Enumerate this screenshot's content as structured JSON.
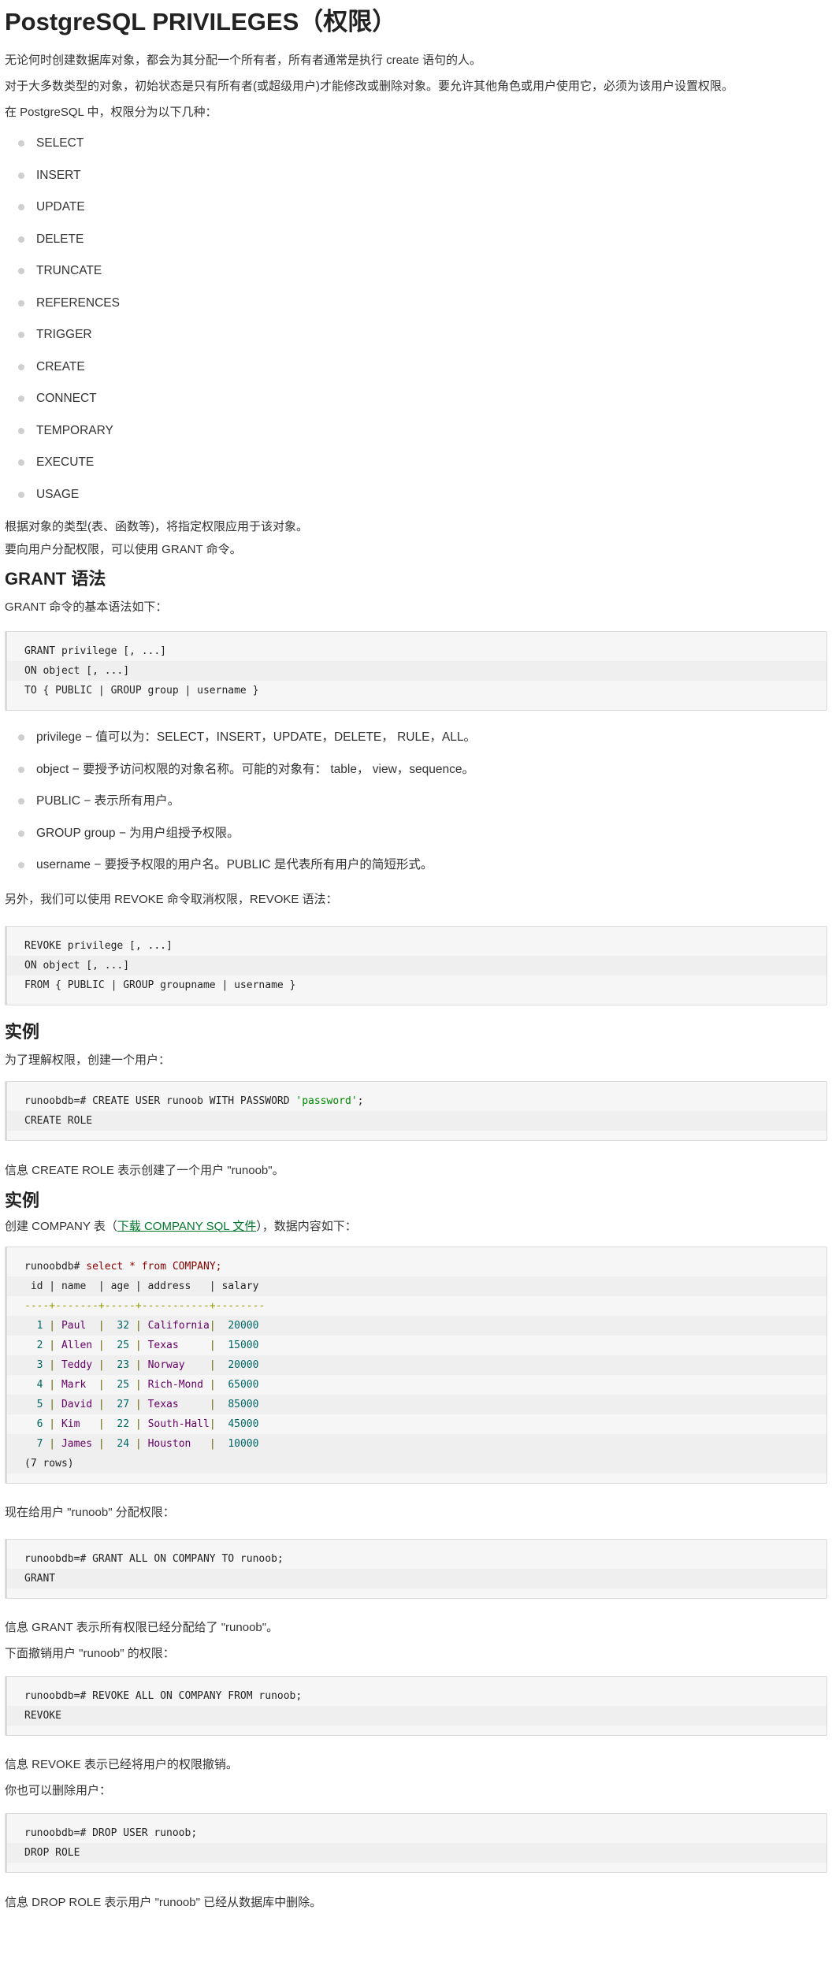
{
  "title": "PostgreSQL PRIVILEGES（权限）",
  "intro": [
    "无论何时创建数据库对象，都会为其分配一个所有者，所有者通常是执行 create 语句的人。",
    "对于大多数类型的对象，初始状态是只有所有者(或超级用户)才能修改或删除对象。要允许其他角色或用户使用它，必须为该用户设置权限。",
    "在 PostgreSQL 中，权限分为以下几种："
  ],
  "privileges": [
    "SELECT",
    "INSERT",
    "UPDATE",
    "DELETE",
    "TRUNCATE",
    "REFERENCES",
    "TRIGGER",
    "CREATE",
    "CONNECT",
    "TEMPORARY",
    "EXECUTE",
    "USAGE"
  ],
  "after_list": [
    "根据对象的类型(表、函数等)，将指定权限应用于该对象。",
    "要向用户分配权限，可以使用 GRANT 命令。"
  ],
  "grant_section": {
    "heading": "GRANT 语法",
    "intro": "GRANT 命令的基本语法如下：",
    "params": [
      "privilege − 值可以为：SELECT，INSERT，UPDATE，DELETE， RULE，ALL。",
      "object − 要授予访问权限的对象名称。可能的对象有： table， view，sequence。",
      "PUBLIC − 表示所有用户。",
      "GROUP group − 为用户组授予权限。",
      "username − 要授予权限的用户名。PUBLIC 是代表所有用户的简短形式。"
    ],
    "revoke_intro": "另外，我们可以使用 REVOKE 命令取消权限，REVOKE 语法："
  },
  "example1": {
    "heading": "实例",
    "intro": "为了理解权限，创建一个用户：",
    "after": "信息 CREATE ROLE 表示创建了一个用户 \"runoob\"。"
  },
  "example2": {
    "heading": "实例",
    "intro_before_link": "创建 COMPANY 表（",
    "link_text": "下载 COMPANY SQL 文件",
    "intro_after_link": "），数据内容如下：",
    "prompt": "runoobdb# ",
    "query": "select * from COMPANY;",
    "columns": [
      "id",
      "name",
      "age",
      "address",
      "salary"
    ],
    "header_line": " id | name  | age | address   | salary",
    "divider_line": "----+-------+-----+-----------+--------",
    "rows": [
      {
        "id": "1",
        "name": "Paul",
        "age": "32",
        "address": "California",
        "salary": "20000"
      },
      {
        "id": "2",
        "name": "Allen",
        "age": "25",
        "address": "Texas",
        "salary": "15000"
      },
      {
        "id": "3",
        "name": "Teddy",
        "age": "23",
        "address": "Norway",
        "salary": "20000"
      },
      {
        "id": "4",
        "name": "Mark",
        "age": "25",
        "address": "Rich-Mond",
        "salary": "65000"
      },
      {
        "id": "5",
        "name": "David",
        "age": "27",
        "address": "Texas",
        "salary": "85000"
      },
      {
        "id": "6",
        "name": "Kim",
        "age": "22",
        "address": "South-Hall",
        "salary": "45000"
      },
      {
        "id": "7",
        "name": "James",
        "age": "24",
        "address": "Houston",
        "salary": "10000"
      }
    ],
    "row_count": "(7 rows)",
    "grant_intro": "现在给用户 \"runoob\" 分配权限：",
    "grant_after": "信息 GRANT 表示所有权限已经分配给了 \"runoob\"。",
    "revoke_intro": "下面撤销用户 \"runoob\" 的权限：",
    "revoke_after": "信息 REVOKE 表示已经将用户的权限撤销。",
    "drop_intro": "你也可以删除用户：",
    "drop_after": "信息 DROP ROLE 表示用户 \"runoob\" 已经从数据库中删除。"
  },
  "code": {
    "grant": [
      "GRANT privilege [, ...]",
      "ON object [, ...]",
      "TO { PUBLIC | GROUP group | username }"
    ],
    "revoke": [
      "REVOKE privilege [, ...]",
      "ON object [, ...]",
      "FROM { PUBLIC | GROUP groupname | username }"
    ],
    "create_user": {
      "prefix": "runoobdb=# CREATE USER runoob WITH PASSWORD ",
      "password": "'password'",
      "suffix": ";",
      "result": "CREATE ROLE"
    },
    "grant_all": {
      "cmd": "runoobdb=# GRANT ALL ON COMPANY TO runoob;",
      "result": "GRANT"
    },
    "revoke_all": {
      "cmd": "runoobdb=# REVOKE ALL ON COMPANY FROM runoob;",
      "result": "REVOKE"
    },
    "drop_user": {
      "cmd": "runoobdb=# DROP USER runoob;",
      "result": "DROP ROLE"
    }
  }
}
